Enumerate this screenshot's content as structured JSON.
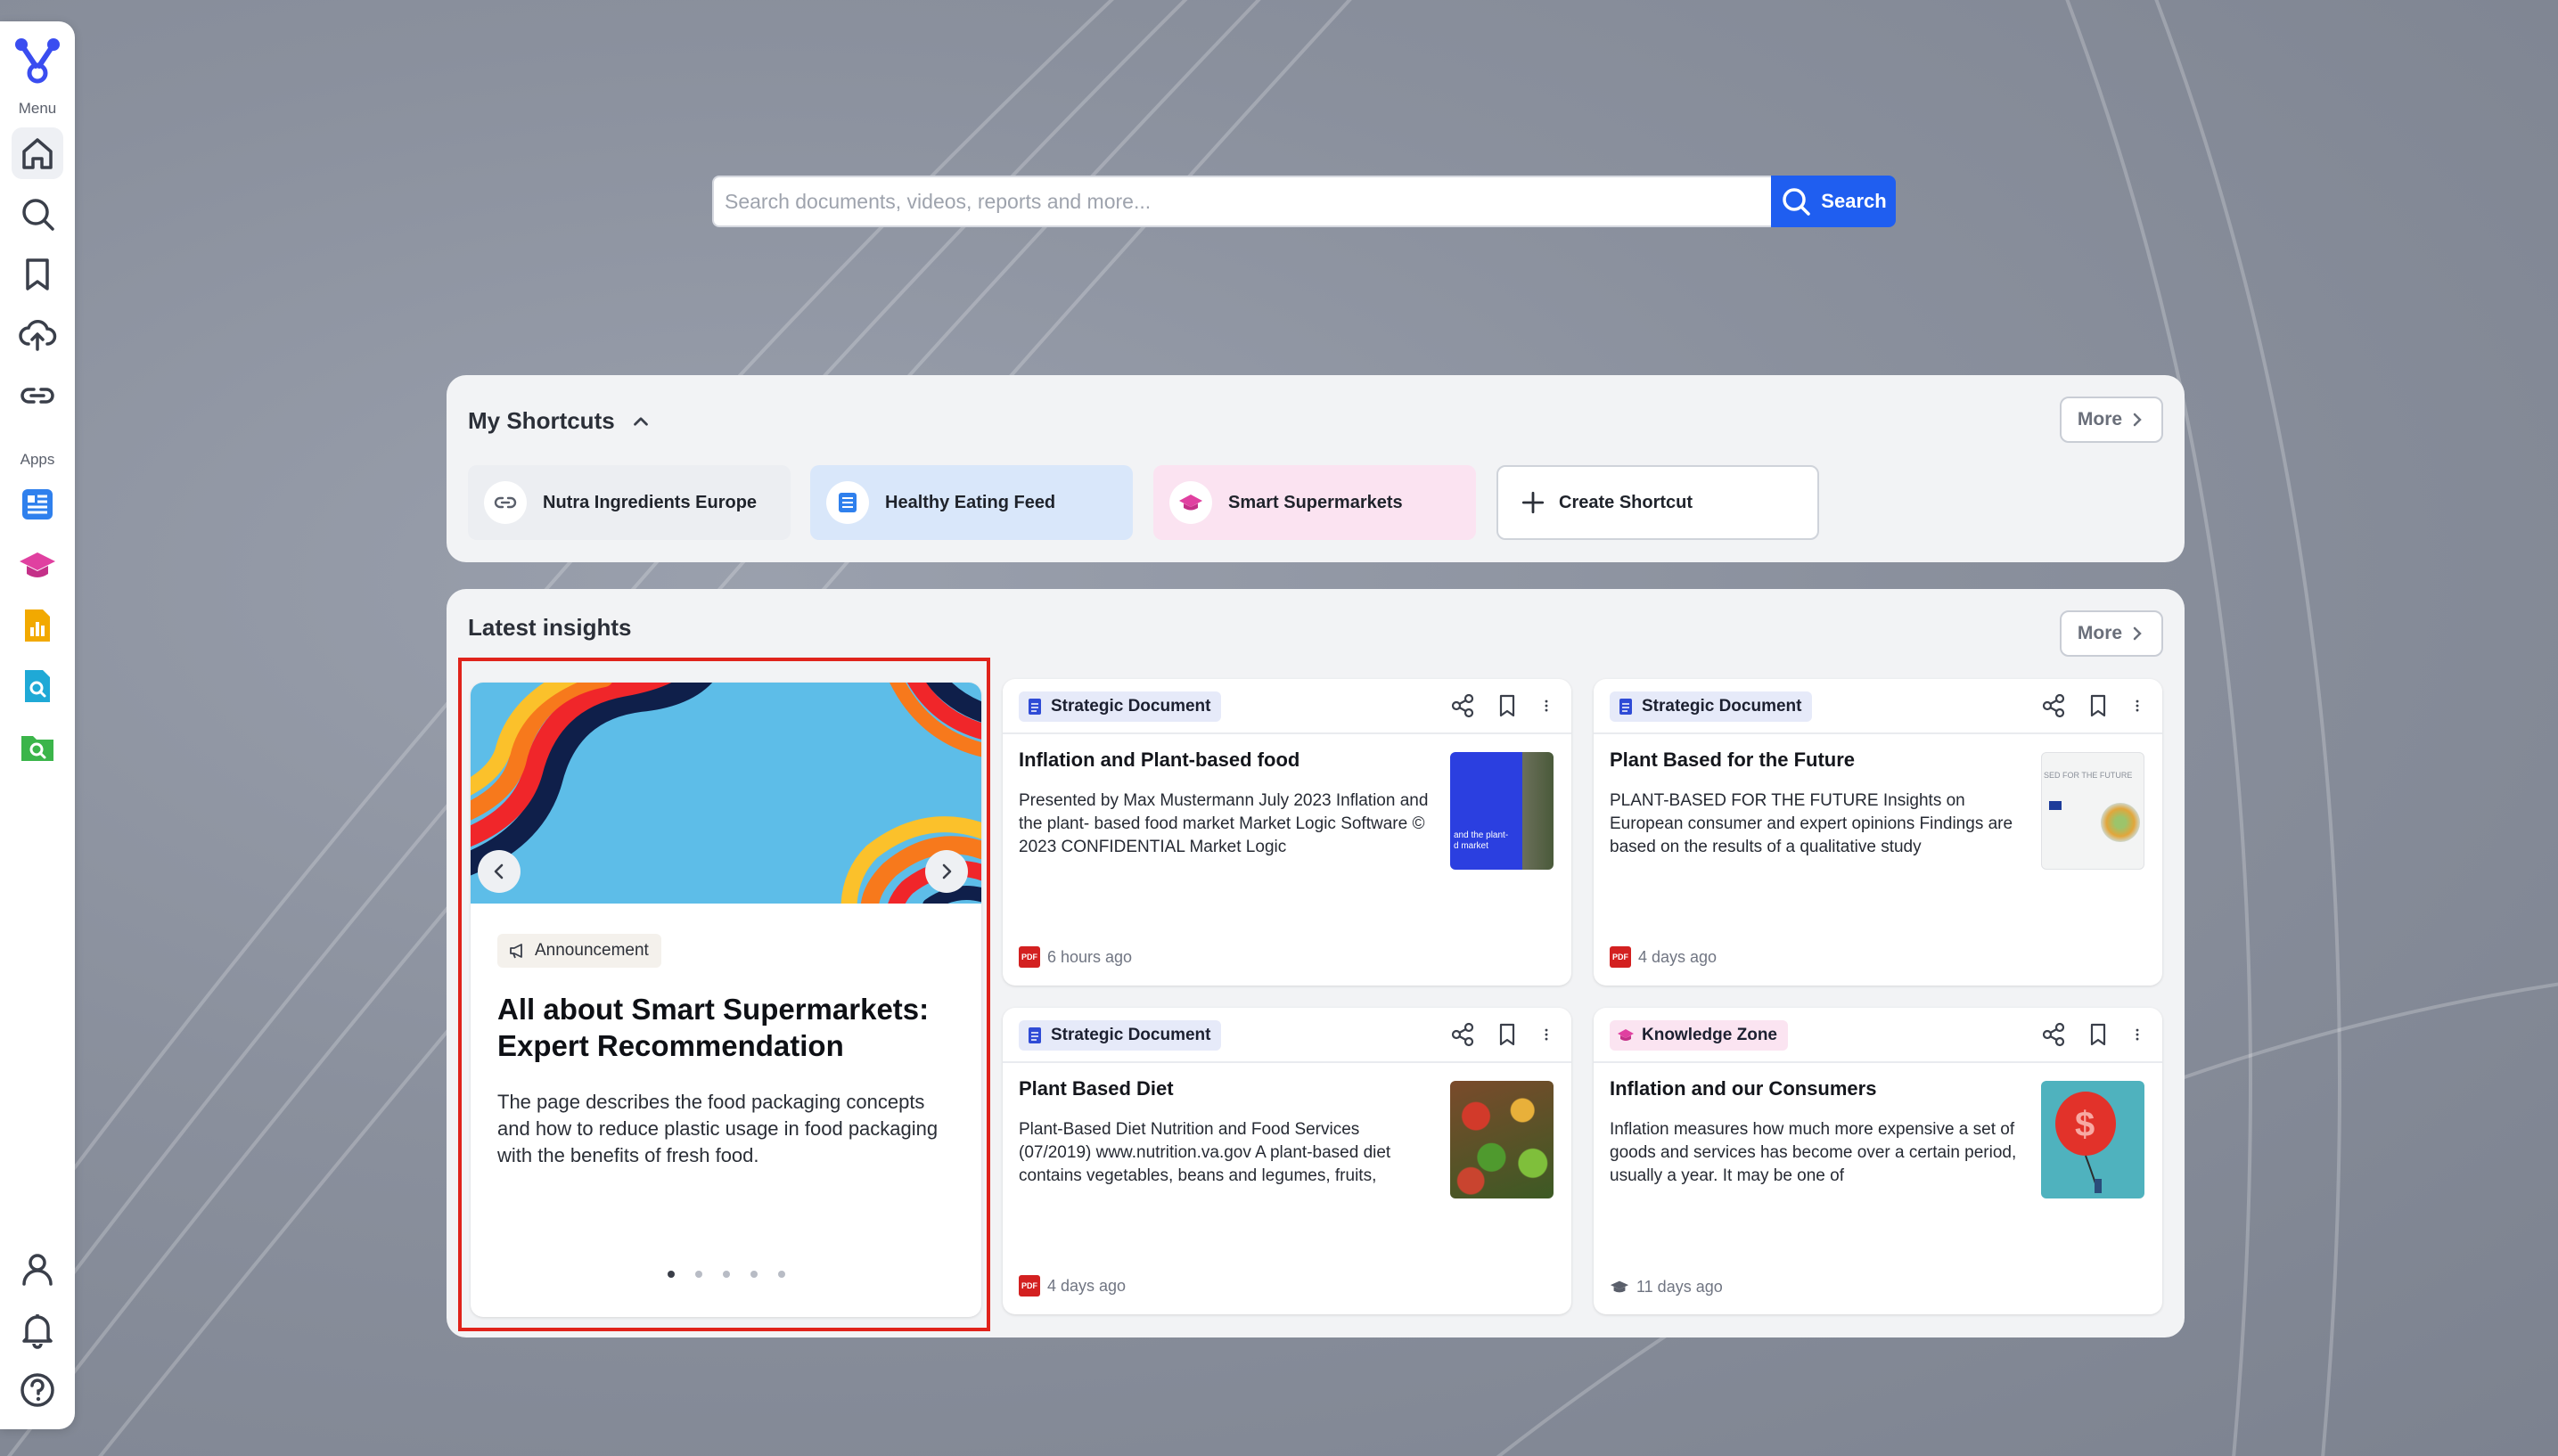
{
  "sidebar": {
    "menu_label": "Menu",
    "apps_label": "Apps",
    "menu_items": [
      {
        "name": "home-icon",
        "active": true
      },
      {
        "name": "search-icon"
      },
      {
        "name": "bookmark-icon"
      },
      {
        "name": "upload-cloud-icon"
      },
      {
        "name": "link-icon"
      }
    ],
    "apps": [
      {
        "name": "news-app-icon",
        "color": "#2f80ed"
      },
      {
        "name": "knowledge-zone-icon",
        "color": "#e040a0"
      },
      {
        "name": "reports-app-icon",
        "color": "#f2a900"
      },
      {
        "name": "document-search-app-icon",
        "color": "#1fa9d6"
      },
      {
        "name": "folder-search-app-icon",
        "color": "#3bb54a"
      }
    ],
    "bottom_items": [
      "user-icon",
      "bell-icon",
      "help-icon"
    ]
  },
  "search": {
    "placeholder": "Search documents, videos, reports and more...",
    "button_label": "Search"
  },
  "shortcuts": {
    "title": "My Shortcuts",
    "more_label": "More",
    "items": [
      {
        "label": "Nutra Ingredients Europe",
        "icon": "link-icon",
        "bg": "#eceef2"
      },
      {
        "label": "Healthy Eating Feed",
        "icon": "news-app-icon",
        "bg": "#d9e7fa"
      },
      {
        "label": "Smart Supermarkets",
        "icon": "knowledge-zone-icon",
        "bg": "#fbe3f1"
      }
    ],
    "create_label": "Create Shortcut"
  },
  "insights": {
    "title": "Latest insights",
    "more_label": "More",
    "featured": {
      "tag": "Announcement",
      "title": "All about Smart Supermarkets: Expert Recommendation",
      "description": "The page describes the food packaging concepts and how to reduce plastic usage in food packaging with the benefits of fresh food.",
      "slides": 5,
      "active_slide": 0
    },
    "cards": [
      {
        "tag": "Strategic Document",
        "title": "Inflation and Plant-based food",
        "description": "Presented by Max Mustermann July 2023 Inflation and the plant- based food market Market Logic Software © 2023 CONFIDENTIAL Market Logic",
        "time": "6 hours ago",
        "file_type": "PDF",
        "thumb_caption": "and the plant-\nd market"
      },
      {
        "tag": "Strategic Document",
        "title": "Plant Based for the Future",
        "description": "PLANT-BASED FOR THE FUTURE Insights on European consumer and expert opinions Findings are based on the results of a qualitative study",
        "time": "4 days ago",
        "file_type": "PDF",
        "thumb_caption": "SED FOR THE FUTURE"
      },
      {
        "tag": "Strategic Document",
        "title": "Plant Based Diet",
        "description": "Plant-Based Diet Nutrition and Food Services (07/2019) www.nutrition.va.gov A plant-based diet contains vegetables, beans and legumes, fruits,",
        "time": "4 days ago",
        "file_type": "PDF"
      },
      {
        "tag": "Knowledge Zone",
        "title": "Inflation and our Consumers",
        "description": "Inflation measures how much more expensive a set of goods and services has become over a certain period, usually a year. It may be one of",
        "time": "11 days ago",
        "file_type": "knowledge-zone"
      }
    ]
  }
}
